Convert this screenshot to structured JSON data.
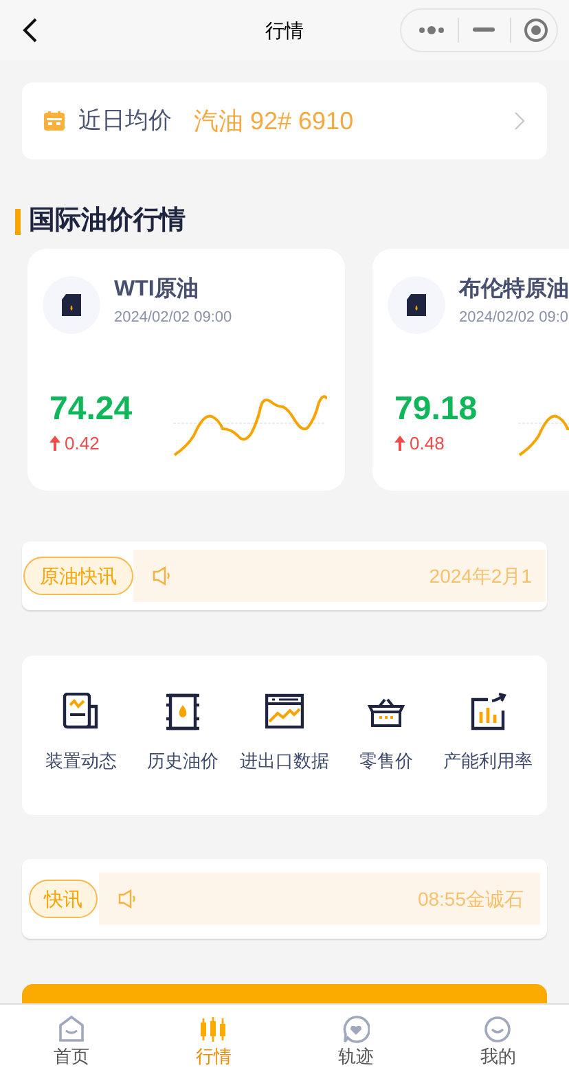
{
  "nav": {
    "title": "行情"
  },
  "average_price": {
    "label": "近日均价",
    "value": "汽油 92# 6910"
  },
  "section_title": "国际油价行情",
  "oil_cards": [
    {
      "name": "WTI原油",
      "time": "2024/02/02 09:00",
      "price": "74.24",
      "change": "0.42",
      "kind": "rise"
    },
    {
      "name": "布伦特原油",
      "time": "2024/02/02 09:0",
      "price": "79.18",
      "change": "0.48",
      "kind": "rise"
    }
  ],
  "crude_news": {
    "badge": "原油快讯",
    "text": "2024年2月1"
  },
  "shortcuts": [
    {
      "label": "装置动态",
      "kind": "report"
    },
    {
      "label": "历史油价",
      "kind": "barrel"
    },
    {
      "label": "进出口数据",
      "kind": "screen"
    },
    {
      "label": "零售价",
      "kind": "basket"
    },
    {
      "label": "产能利用率",
      "kind": "growth"
    }
  ],
  "flash_news": {
    "badge": "快讯",
    "text": "08:55金诚石"
  },
  "tab_bar": [
    {
      "label": "首页",
      "kind": "home",
      "selected": false
    },
    {
      "label": "行情",
      "kind": "market",
      "selected": true
    },
    {
      "label": "轨迹",
      "kind": "track",
      "selected": false
    },
    {
      "label": "我的",
      "kind": "profile",
      "selected": false
    }
  ]
}
